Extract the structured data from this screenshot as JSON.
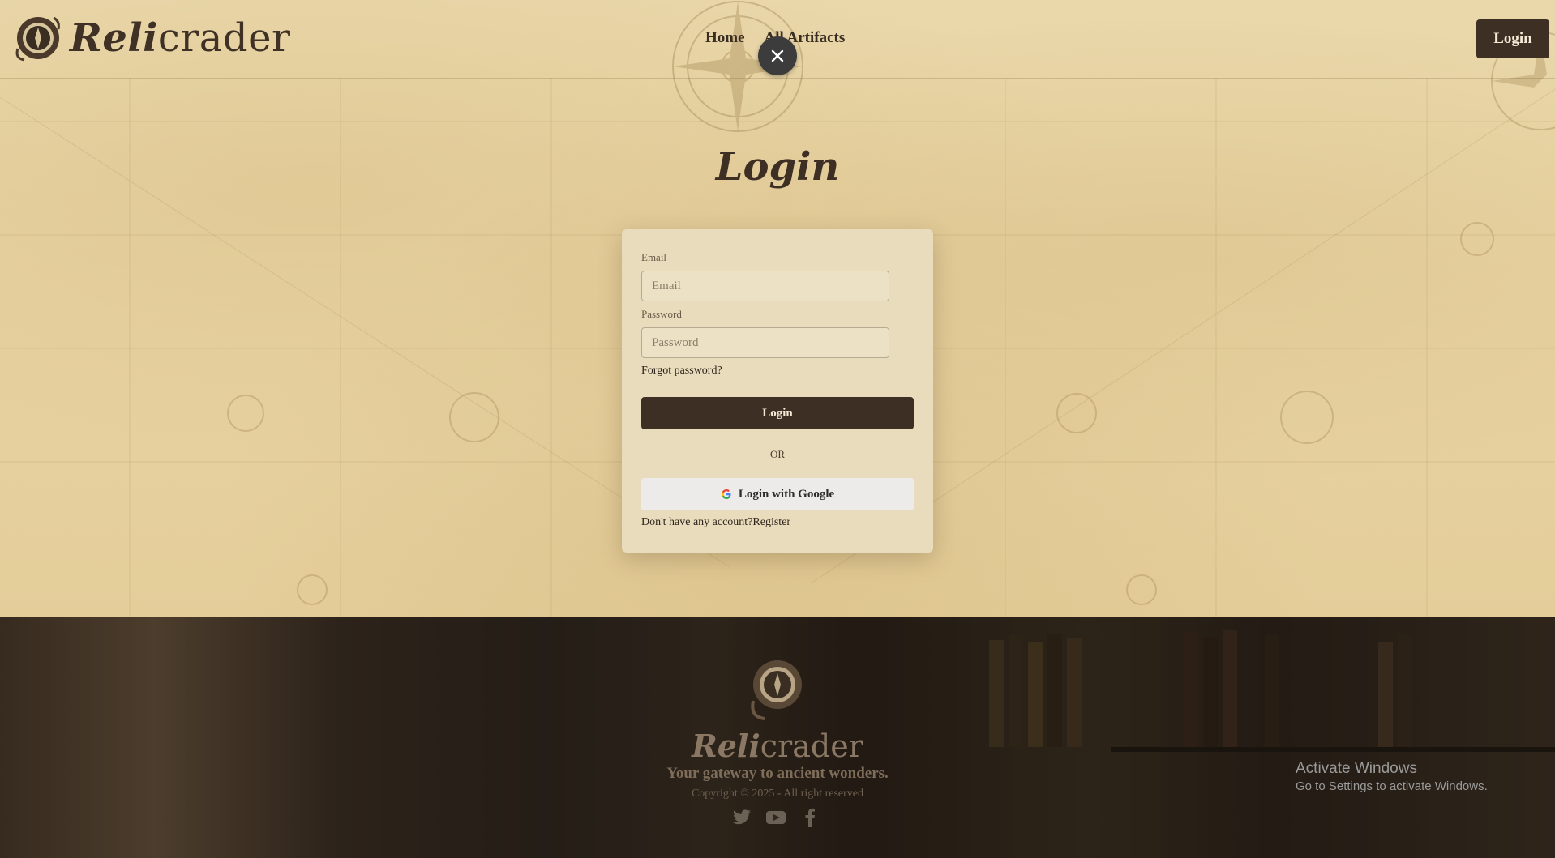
{
  "header": {
    "brand_bold": "Reli",
    "brand_rest": "crader",
    "nav": [
      {
        "label": "Home"
      },
      {
        "label": "All Artifacts"
      }
    ],
    "login_button": "Login",
    "close_icon": "close-icon"
  },
  "main": {
    "title": "Login",
    "form": {
      "email_label": "Email",
      "email_placeholder": "Email",
      "email_value": "",
      "password_label": "Password",
      "password_placeholder": "Password",
      "password_value": "",
      "forgot_password": "Forgot password?",
      "login_button": "Login",
      "divider_text": "OR",
      "google_button": "Login with Google",
      "no_account_text": "Don't have any account?",
      "register_link": "Register"
    }
  },
  "footer": {
    "brand_bold": "Reli",
    "brand_rest": "crader",
    "tagline": "Your gateway to ancient wonders.",
    "copyright": "Copyright © 2025 - All right reserved",
    "socials": [
      "twitter-icon",
      "youtube-icon",
      "facebook-icon"
    ]
  },
  "overlay": {
    "activate_title": "Activate Windows",
    "activate_sub": "Go to Settings to activate Windows."
  },
  "colors": {
    "primary_dark": "#3d2f24",
    "parchment": "#e7d2a1",
    "card": "#e9dcbc"
  }
}
